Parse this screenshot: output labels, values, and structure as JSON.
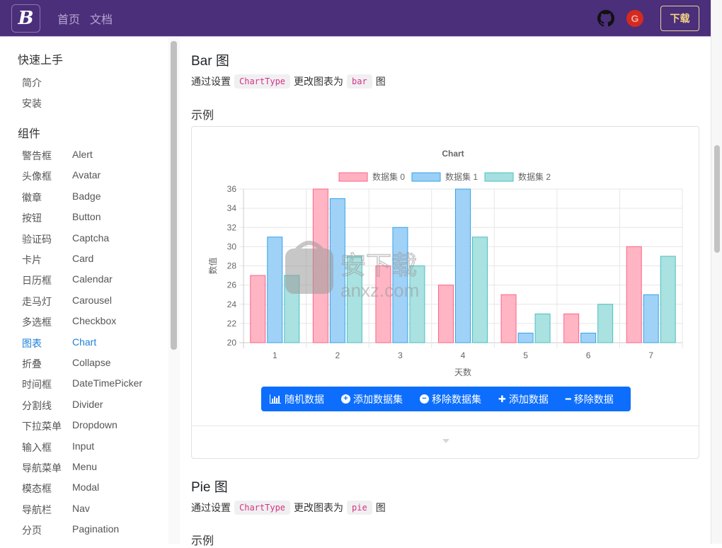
{
  "navbar": {
    "brand": "B",
    "links": [
      "首页",
      "文档"
    ],
    "github_icon": "github-icon",
    "gitee_icon": "gitee-icon",
    "gitee_glyph": "G",
    "download_label": "下载"
  },
  "sidebar": {
    "groups": [
      {
        "title": "快速上手",
        "items": [
          {
            "cn": "简介",
            "en": ""
          },
          {
            "cn": "安装",
            "en": ""
          }
        ]
      },
      {
        "title": "组件",
        "items": [
          {
            "cn": "警告框",
            "en": "Alert"
          },
          {
            "cn": "头像框",
            "en": "Avatar"
          },
          {
            "cn": "徽章",
            "en": "Badge"
          },
          {
            "cn": "按钮",
            "en": "Button"
          },
          {
            "cn": "验证码",
            "en": "Captcha"
          },
          {
            "cn": "卡片",
            "en": "Card"
          },
          {
            "cn": "日历框",
            "en": "Calendar"
          },
          {
            "cn": "走马灯",
            "en": "Carousel"
          },
          {
            "cn": "多选框",
            "en": "Checkbox"
          },
          {
            "cn": "图表",
            "en": "Chart",
            "active": true
          },
          {
            "cn": "折叠",
            "en": "Collapse"
          },
          {
            "cn": "时间框",
            "en": "DateTimePicker"
          },
          {
            "cn": "分割线",
            "en": "Divider"
          },
          {
            "cn": "下拉菜单",
            "en": "Dropdown"
          },
          {
            "cn": "输入框",
            "en": "Input"
          },
          {
            "cn": "导航菜单",
            "en": "Menu"
          },
          {
            "cn": "模态框",
            "en": "Modal"
          },
          {
            "cn": "导航栏",
            "en": "Nav"
          },
          {
            "cn": "分页",
            "en": "Pagination"
          }
        ]
      }
    ]
  },
  "main": {
    "bar_section": {
      "title": "Bar 图",
      "desc_prefix": "通过设置",
      "desc_code1": "ChartType",
      "desc_middle": "更改图表为",
      "desc_code2": "bar",
      "desc_suffix": "图",
      "example_label": "示例"
    },
    "buttons": [
      {
        "icon": "bar-chart-icon",
        "label": "随机数据"
      },
      {
        "icon": "plus-circle-icon",
        "label": "添加数据集"
      },
      {
        "icon": "minus-circle-icon",
        "label": "移除数据集"
      },
      {
        "icon": "plus-icon",
        "label": "添加数据"
      },
      {
        "icon": "minus-icon",
        "label": "移除数据"
      }
    ],
    "pie_section": {
      "title": "Pie 图",
      "desc_prefix": "通过设置",
      "desc_code1": "ChartType",
      "desc_middle": "更改图表为",
      "desc_code2": "pie",
      "desc_suffix": "图",
      "example_label": "示例"
    },
    "watermark": {
      "text": "安下载",
      "sub": "anxz.com"
    }
  },
  "chart_data": {
    "type": "bar",
    "title": "Chart",
    "xlabel": "天数",
    "ylabel": "数值",
    "categories": [
      "1",
      "2",
      "3",
      "4",
      "5",
      "6",
      "7"
    ],
    "ylim": [
      20,
      36
    ],
    "yticks": [
      20,
      22,
      24,
      26,
      28,
      30,
      32,
      34,
      36
    ],
    "grid": true,
    "legend_position": "top",
    "series": [
      {
        "name": "数据集 0",
        "values": [
          27,
          36,
          28,
          26,
          25,
          23,
          30
        ],
        "fill": "#ffb1c1",
        "stroke": "#ff6384"
      },
      {
        "name": "数据集 1",
        "values": [
          31,
          35,
          32,
          36,
          21,
          21,
          25
        ],
        "fill": "#9ad0f5",
        "stroke": "#36a2eb"
      },
      {
        "name": "数据集 2",
        "values": [
          27,
          29,
          28,
          31,
          23,
          24,
          29
        ],
        "fill": "#a5dfdf",
        "stroke": "#4bc0c0"
      }
    ]
  }
}
